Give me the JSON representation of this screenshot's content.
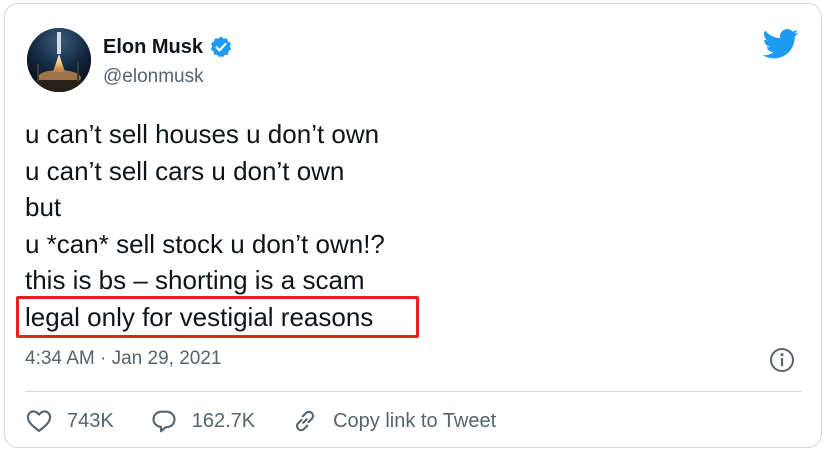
{
  "author": {
    "display_name": "Elon Musk",
    "handle": "@elonmusk",
    "verified": true
  },
  "tweet": {
    "lines": [
      "u can’t sell houses u don’t own",
      "u can’t sell cars u don’t own",
      "but",
      "u *can* sell stock u don’t own!?",
      "this is bs – shorting is a scam",
      "legal only for vestigial reasons"
    ],
    "timestamp": "4:34 AM · Jan 29, 2021"
  },
  "actions": {
    "likes": "743K",
    "replies": "162.7K",
    "copy_link_label": "Copy link to Tweet"
  },
  "icons": {
    "brand": "twitter-bird-icon",
    "verified": "verified-badge-icon",
    "info": "info-icon",
    "like": "heart-icon",
    "reply": "reply-bubble-icon",
    "link": "link-icon"
  },
  "colors": {
    "twitter_blue": "#1d9bf0",
    "highlight_red": "#e3231f",
    "muted_text": "#536471"
  }
}
